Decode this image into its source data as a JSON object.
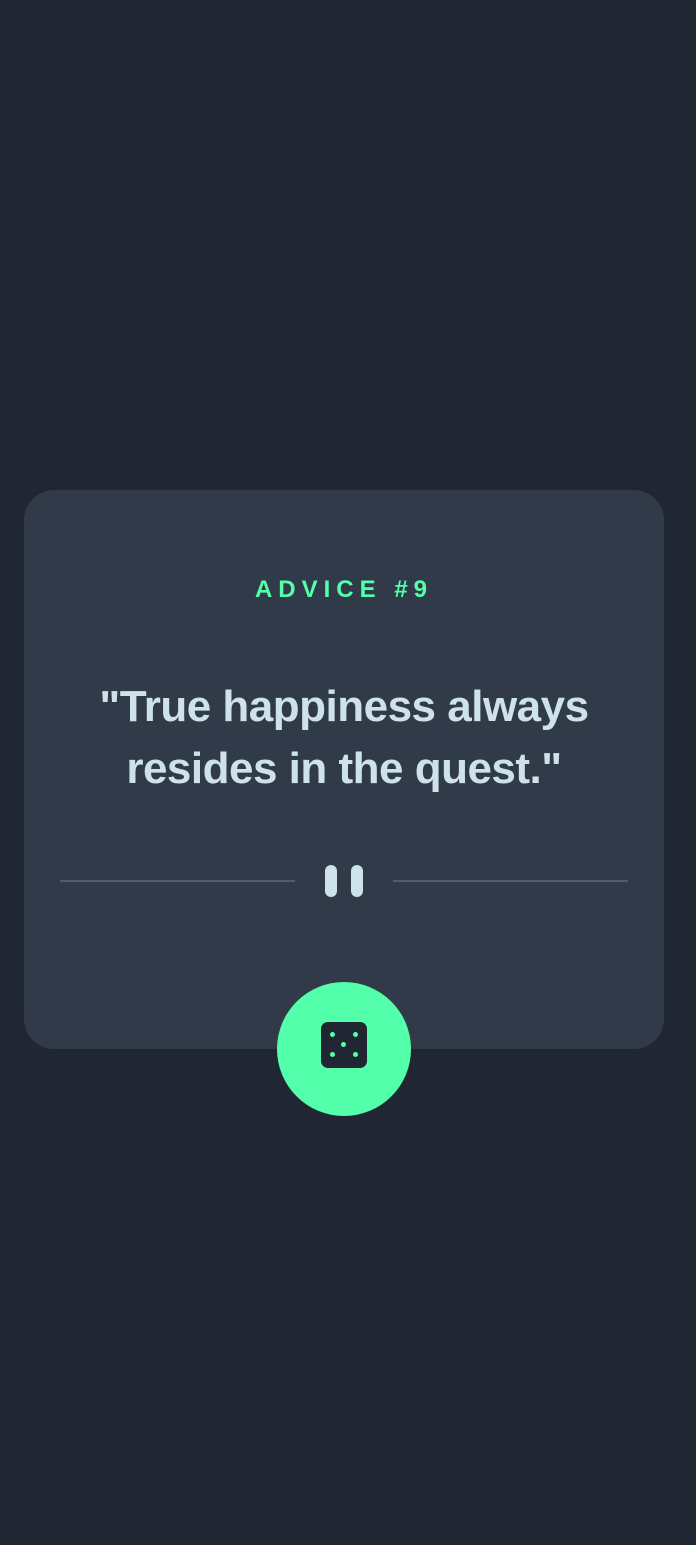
{
  "card": {
    "advice_label": "ADVICE #9",
    "quote": "\"True happiness always resides in the quest.\""
  },
  "icons": {
    "divider": "pause-icon",
    "button": "dice-icon"
  },
  "colors": {
    "background": "#202632",
    "card": "#313a48",
    "accent": "#53ffaa",
    "text": "#cee3e9",
    "divider_line": "#4f5d74"
  }
}
